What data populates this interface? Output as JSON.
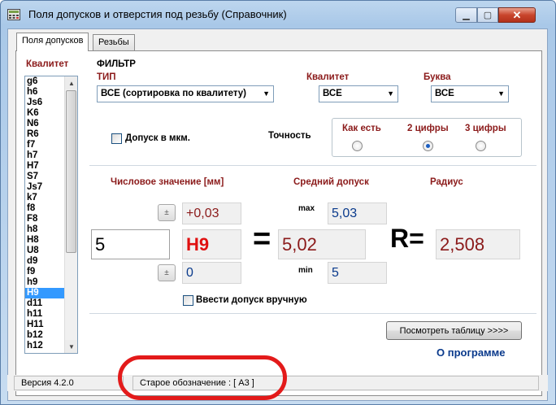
{
  "window": {
    "title": "Поля допусков и отверстия под резьбу (Справочник)",
    "icons": {
      "app": "calculator-icon",
      "minimize": "minimize-icon",
      "maximize": "maximize-icon",
      "close": "close-icon"
    }
  },
  "tabs": [
    {
      "label": "Поля допусков",
      "active": true
    },
    {
      "label": "Резьбы",
      "active": false
    }
  ],
  "kvalitet_list": {
    "label": "Квалитет",
    "items": [
      "g6",
      "h6",
      "Js6",
      "K6",
      "N6",
      "R6",
      "f7",
      "h7",
      "H7",
      "S7",
      "Js7",
      "k7",
      "f8",
      "F8",
      "h8",
      "H8",
      "U8",
      "d9",
      "f9",
      "h9",
      "H9",
      "d11",
      "h11",
      "H11",
      "b12",
      "h12"
    ],
    "selected": "H9"
  },
  "filter": {
    "title": "ФИЛЬТР",
    "type_label": "ТИП",
    "type_value": "ВСЕ (сортировка по квалитету)",
    "kvalitet_label": "Квалитет",
    "kvalitet_value": "ВСЕ",
    "letter_label": "Буква",
    "letter_value": "ВСЕ"
  },
  "tolerance_mkm": {
    "label": "Допуск в мкм.",
    "checked": false
  },
  "precision": {
    "label": "Точность",
    "options": [
      {
        "label": "Как есть",
        "selected": false
      },
      {
        "label": "2 цифры",
        "selected": true
      },
      {
        "label": "3 цифры",
        "selected": false
      }
    ]
  },
  "calc": {
    "numeric_label": "Числовое значение [мм]",
    "mid_label": "Средний допуск",
    "radius_label": "Радиус",
    "pm_symbol": "±",
    "upper_dev": "+0,03",
    "lower_dev": "0",
    "input_value": "5",
    "tolerance_field": "H9",
    "equals": "=",
    "mid_value": "5,02",
    "max_label": "max",
    "max_value": "5,03",
    "min_label": "min",
    "min_value": "5",
    "r_label": "R=",
    "r_value": "2,508"
  },
  "manual_entry": {
    "label": "Ввести допуск вручную",
    "checked": false
  },
  "view_table_button": "Посмотреть таблицу >>>>",
  "about_link": "О программе",
  "status": {
    "version": "Версия 4.2.0",
    "old_designation": "Старое обозначение : [ A3 ]"
  },
  "colors": {
    "accent_red": "#8b1a1a",
    "link_blue": "#0a3a8c",
    "selection": "#3399ff",
    "annotation": "#e31a1a"
  }
}
